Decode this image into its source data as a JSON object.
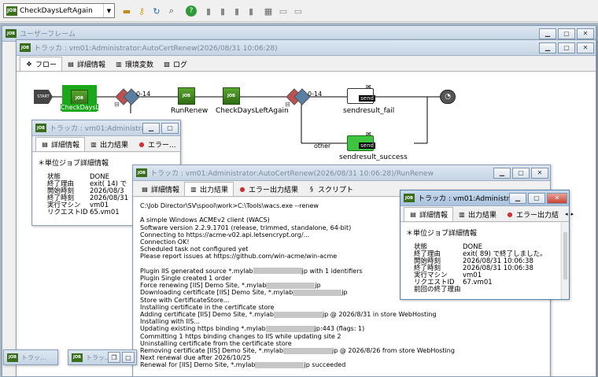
{
  "toolbar": {
    "combo_value": "CheckDaysLeftAgain",
    "combo_icon": "JOB",
    "icons": [
      "folder-icon",
      "key-icon",
      "refresh-icon",
      "search-icon",
      "help-icon",
      "doc-icon",
      "doc-icon",
      "doc-icon",
      "doc-icon",
      "grid-icon",
      "note-icon",
      "note-icon"
    ]
  },
  "user_frame": {
    "title": "ユーザーフレーム"
  },
  "tracker_main": {
    "title": "トラッカ : vm01:Administrator:AutoCertRenew(2026/08/31 10:06:28)",
    "tabs": [
      "フロー",
      "詳細情報",
      "環境変数",
      "ログ"
    ]
  },
  "flow": {
    "start": "START",
    "job_icon": "JOB",
    "nodes": [
      "CheckDaysLeft",
      "RunRenew",
      "CheckDaysLeftAgain",
      "sendresult_fail",
      "sendresult_success"
    ],
    "branch_labels": [
      "0-14",
      "0-14",
      "other"
    ],
    "send": "send",
    "minus": "⊟"
  },
  "tracker_small": {
    "title": "トラッカ : vm01:Administrat...",
    "tabs": [
      "詳細情報",
      "出力結果",
      "エラー..."
    ],
    "section": "＊単位ジョブ詳細情報",
    "rows": [
      {
        "k": "状態",
        "v": "DONE"
      },
      {
        "k": "終了理由",
        "v": "exit( 14) で"
      },
      {
        "k": "開始時刻",
        "v": "2026/08/3"
      },
      {
        "k": "終了時刻",
        "v": "2026/08/31"
      },
      {
        "k": "実行マシン",
        "v": "vm01"
      },
      {
        "k": "リクエストID",
        "v": "65.vm01"
      }
    ]
  },
  "tracker_renew": {
    "title": "トラッカ : vm01:Administrator:AutoCertRenew(2026/08/31 10:06:28)/RunRenew",
    "tabs": [
      "詳細情報",
      "出力結果",
      "エラー出力結果",
      "スクリプト"
    ],
    "lines": [
      "C:\\Job Director\\SV\\spool\\work>C:\\Tools\\wacs.exe --renew",
      "",
      "A simple Windows ACMEv2 client (WACS)",
      "Software version 2.2.9.1701 (release, trimmed, standalone, 64-bit)",
      "Connecting to https://acme-v02.api.letsencrypt.org/...",
      "Connection OK!",
      "Scheduled task not configured yet",
      "Please report issues at https://github.com/win-acme/win-acme",
      "",
      "Plugin IIS generated source *.mylab",
      "Plugin Single created 1 order",
      "Force renewing [IIS] Demo Site, *.mylab",
      "Downloading certificate [IIS] Demo Site, *.mylab",
      "Store with CertificateStore...",
      "Installing certificate in the certificate store",
      "Adding certificate [IIS] Demo Site, *.mylab",
      "Installing with IIS...",
      "Updating existing https binding *.mylab",
      "Committing 1 https binding changes to IIS while updating site 2",
      "Uninstalling certificate from the certificate store",
      "Removing certificate [IIS] Demo Site, *.mylab",
      "Next renewal due after 2026/10/25",
      "Renewal for [IIS] Demo Site, *.mylab"
    ],
    "line_suffix": {
      "9": "jp with 1 identifiers",
      "11": "jp",
      "12": "jp",
      "15": "jp @ 2026/8/31 in store WebHosting",
      "17": "jp:443 (flags: 1)",
      "20": "jp @ 2026/8/26 from store WebHosting",
      "22": "jp succeeded"
    }
  },
  "tracker_right": {
    "title": "トラッカ : vm01:Administrator:A...",
    "tabs": [
      "詳細情報",
      "出力結果",
      "エラー出力結"
    ],
    "section": "＊単位ジョブ詳細情報",
    "rows": [
      {
        "k": "状態",
        "v": "DONE"
      },
      {
        "k": "終了理由",
        "v": "exit( 89) で終了しました。"
      },
      {
        "k": "開始時刻",
        "v": "2026/08/31 10:06:38"
      },
      {
        "k": "終了時刻",
        "v": "2026/08/31 10:06:38"
      },
      {
        "k": "実行マシン",
        "v": "vm01"
      },
      {
        "k": "リクエストID",
        "v": "67.vm01"
      },
      {
        "k": "前回の終了理由",
        "v": ""
      }
    ]
  },
  "minimized": [
    {
      "title": "トラッ..."
    },
    {
      "title": "トラッ..."
    }
  ]
}
